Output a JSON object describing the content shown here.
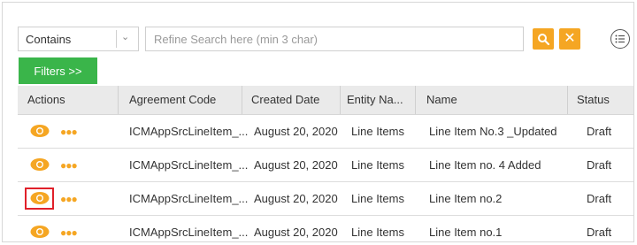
{
  "search": {
    "filter_mode": "Contains",
    "placeholder": "Refine Search here (min 3 char)",
    "value": ""
  },
  "filters_label": "Filters >>",
  "table": {
    "columns": [
      "Actions",
      "Agreement Code",
      "Created Date",
      "Entity Na...",
      "Name",
      "Status"
    ],
    "rows": [
      {
        "code": "ICMAppSrcLineItem_...",
        "date": "August 20, 2020",
        "entity": "Line Items",
        "name": "Line Item No.3 _Updated",
        "status": "Draft"
      },
      {
        "code": "ICMAppSrcLineItem_...",
        "date": "August 20, 2020",
        "entity": "Line Items",
        "name": "Line Item no. 4 Added",
        "status": "Draft"
      },
      {
        "code": "ICMAppSrcLineItem_...",
        "date": "August 20, 2020",
        "entity": "Line Items",
        "name": "Line Item no.2",
        "status": "Draft"
      },
      {
        "code": "ICMAppSrcLineItem_...",
        "date": "August 20, 2020",
        "entity": "Line Items",
        "name": "Line Item no.1",
        "status": "Draft"
      }
    ],
    "highlighted_row": 2
  },
  "icons": {
    "filter_chevron": "chevron-down-icon",
    "search": "search-icon",
    "clear": "close-icon",
    "list": "list-icon",
    "view": "eye-icon",
    "more": "more-dots-icon"
  },
  "colors": {
    "accent_orange": "#f5a623",
    "filters_green": "#3ab54a",
    "highlight_red": "#e0202a",
    "header_bg": "#eaeaea"
  }
}
